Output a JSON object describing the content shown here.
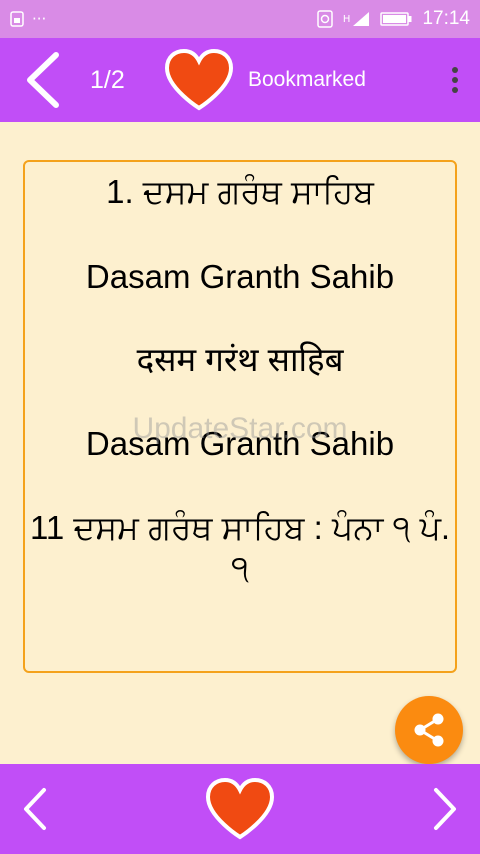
{
  "status_bar": {
    "time": "17:14",
    "left_dots": "···",
    "icons": [
      "sim-icon",
      "alarm-icon",
      "signal-icon",
      "battery-icon"
    ],
    "network_label": "H"
  },
  "toolbar": {
    "page_counter": "1/2",
    "bookmark_status": "Bookmarked",
    "accent_color": "#c14ef7",
    "heart_color": "#f04a12"
  },
  "entry": {
    "line1": "1. ਦਸਮ ਗਰੰਥ ਸਾਹਿਬ",
    "line2": "Dasam Granth Sahib",
    "line3": "दसम गरंथ साहिब",
    "line4": "Dasam Granth Sahib",
    "line5": "11 ਦਸਮ ਗਰੰਥ ਸਾਹਿਬ : ਪੰਨਾ ੧ ਪੰ. ੧"
  },
  "watermark": "UpdateStar.com",
  "bottom_bar": {
    "icons": [
      "chevron-left-icon",
      "heart-icon",
      "chevron-right-icon"
    ]
  }
}
